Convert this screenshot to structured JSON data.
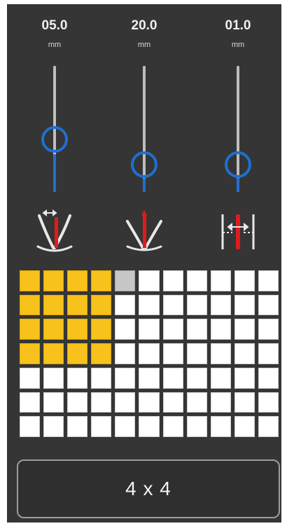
{
  "sliders": [
    {
      "value": "05.0",
      "unit": "mm",
      "level": 0.5,
      "icon": "angle-spread-icon"
    },
    {
      "value": "20.0",
      "unit": "mm",
      "level": 0.25,
      "icon": "angle-narrow-icon"
    },
    {
      "value": "01.0",
      "unit": "mm",
      "level": 0.25,
      "icon": "gap-width-icon"
    }
  ],
  "grid": {
    "cols": 11,
    "rows": 7,
    "selected_cols": 4,
    "selected_rows": 4,
    "hover_cell": {
      "row": 1,
      "col": 5
    }
  },
  "size_button": {
    "label": "4 x 4"
  },
  "colors": {
    "panel": "#353535",
    "accent_blue": "#1f6fd0",
    "selected_yellow": "#f7c21b",
    "indicator_red": "#e11b1b"
  }
}
